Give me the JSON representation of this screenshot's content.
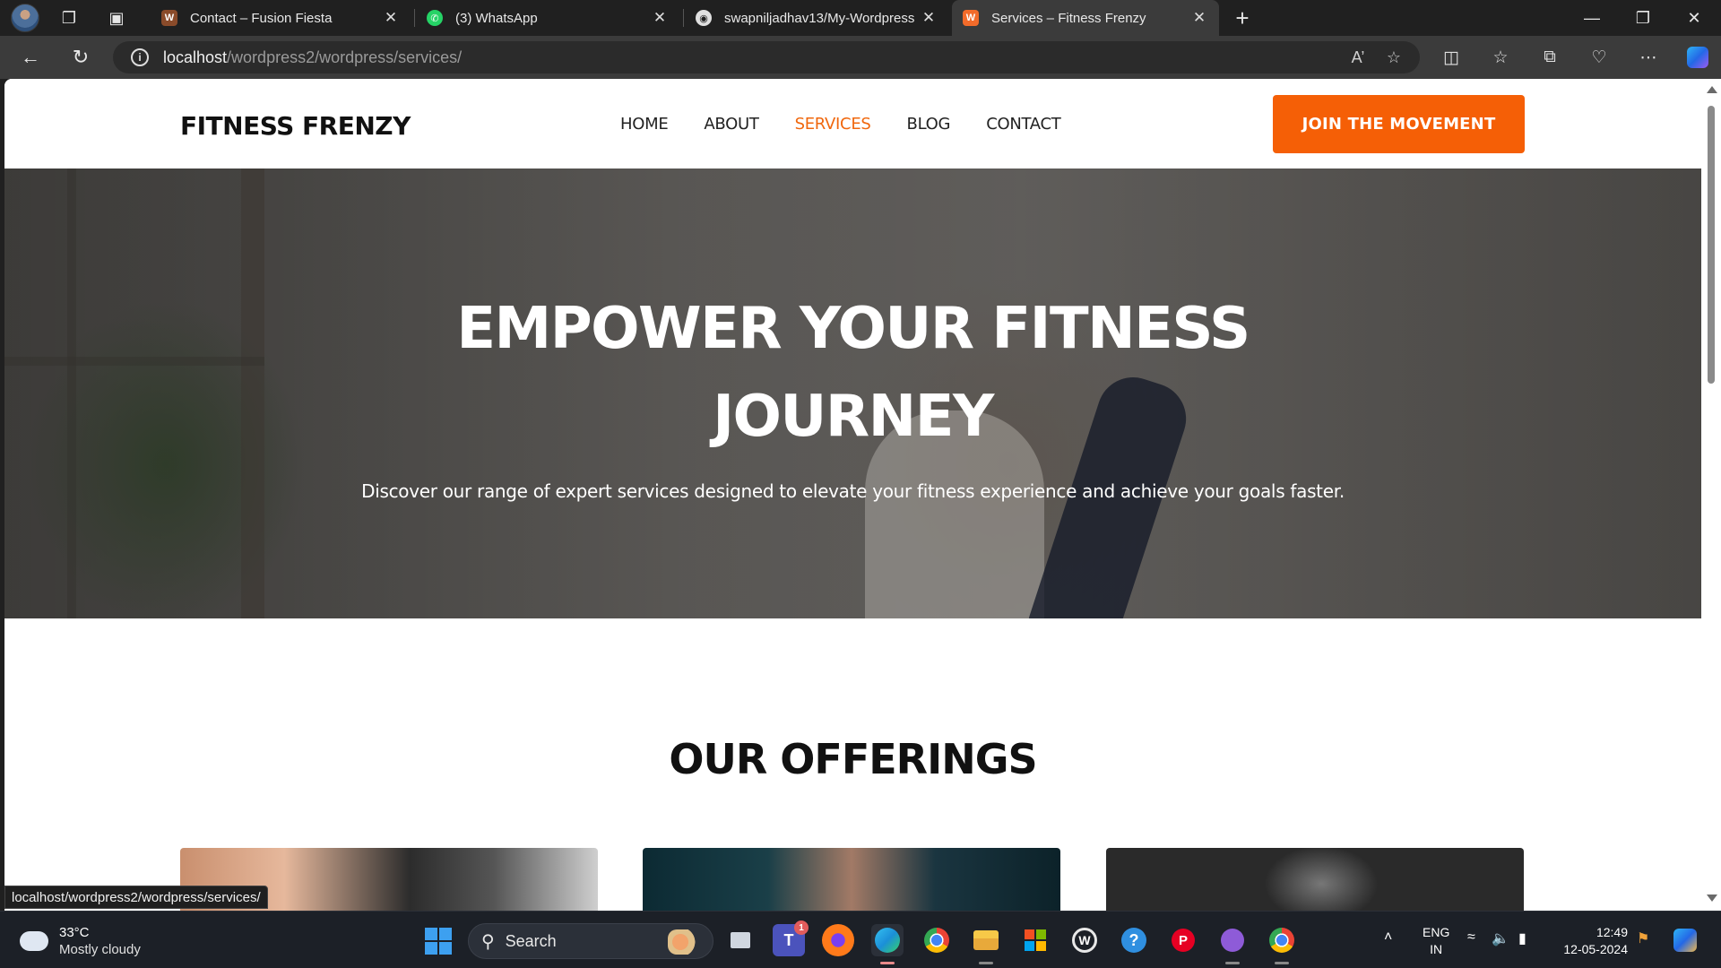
{
  "browser": {
    "tabs": [
      {
        "title": "Contact – Fusion Fiesta",
        "favicon_color": "#8a4b2a"
      },
      {
        "title": "(3) WhatsApp",
        "favicon_color": "#25d366"
      },
      {
        "title": "swapniljadhav13/My-Wordpress",
        "favicon_color": "#e0e0e0"
      },
      {
        "title": "Services – Fitness Frenzy",
        "favicon_color": "#f26b2a"
      }
    ],
    "address": {
      "host": "localhost",
      "path": "/wordpress2/wordpress/services/"
    },
    "status_url": "localhost/wordpress2/wordpress/services/"
  },
  "site": {
    "logo": "FITNESS FRENZY",
    "menu": [
      "HOME",
      "ABOUT",
      "SERVICES",
      "BLOG",
      "CONTACT"
    ],
    "current_menu": "SERVICES",
    "cta": "JOIN THE MOVEMENT",
    "accent_color": "#f55f06",
    "hero": {
      "title_line1": "EMPOWER YOUR FITNESS",
      "title_line2": "JOURNEY",
      "subtitle": "Discover our range of expert services designed to elevate your fitness experience and achieve your goals faster."
    },
    "offerings_title": "OUR OFFERINGS"
  },
  "taskbar": {
    "weather_temp": "33°C",
    "weather_desc": "Mostly cloudy",
    "search_label": "Search",
    "teams_badge": "1",
    "lang_top": "ENG",
    "lang_bottom": "IN",
    "time": "12:49",
    "date": "12-05-2024"
  }
}
